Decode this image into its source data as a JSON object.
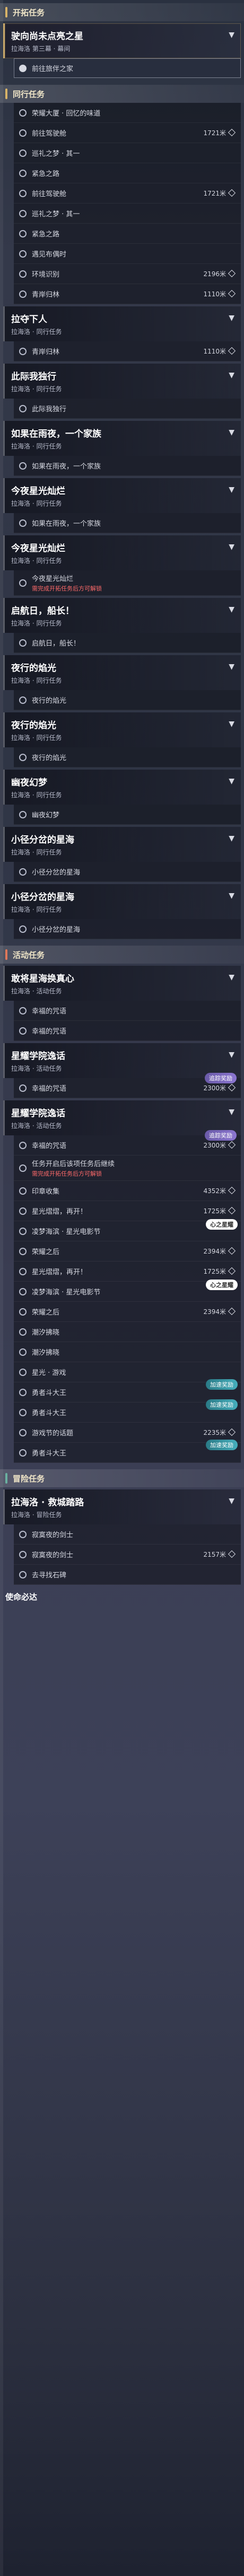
{
  "sections": {
    "trailblaze": {
      "title": "开拓任务"
    },
    "companion": {
      "title": "同行任务"
    },
    "event": {
      "title": "活动任务"
    },
    "adventure": {
      "title": "冒险任务"
    }
  },
  "quests": [
    {
      "title": "驶向尚未点亮之星",
      "sub": "拉海洛 第三幕 · 幕间",
      "steps": [
        {
          "label": "前往旅伴之家",
          "highlight": true
        }
      ]
    },
    {
      "title": "拉夺下人",
      "sub": "拉海洛 · 同行任务"
    },
    {
      "title": "如果在雨夜，一个家族",
      "sub": "拉海洛 · 同行任务"
    },
    {
      "title": "今夜星光灿烂",
      "sub": "拉海洛 · 同行任务"
    },
    {
      "title": "启航日，船长！",
      "sub": "拉海洛 · 同行任务"
    },
    {
      "title": "夜行的焰光",
      "sub": "拉海洛 · 同行任务"
    },
    {
      "title": "幽夜幻梦",
      "sub": "拉海洛 · 同行任务"
    },
    {
      "title": "小径分岔的星海",
      "sub": "拉海洛 · 同行任务"
    },
    {
      "title": "敢将星海换真心",
      "sub": "拉海洛 · 活动任务"
    },
    {
      "title": "星耀学院逸话",
      "sub": "拉海洛 · 活动任务"
    },
    {
      "title": "拉海洛 · 救城踏路",
      "sub": "拉海洛 · 冒险任务"
    },
    {
      "title": "使命必达",
      "sub": ""
    }
  ],
  "steps": {
    "s1": "荣耀大厦 · 回忆的味道",
    "s2": "前往驾驶舱",
    "s3": "巡礼之梦 · 其一",
    "s4": "紧急之路",
    "s5": "前往驾驶舱",
    "s6": "巡礼之梦 · 其一",
    "s7": "紧急之路",
    "s8": "遇见布偶时",
    "s9": "环境识别",
    "s10": "青岸归林",
    "s11": "青岸归林",
    "s12": "此际我独行",
    "s13": "如果在雨夜，一个家族",
    "s14": "如果在雨夜，一个家族",
    "s15": "今夜星光灿烂",
    "s16": "任务开启后该项任务后继续",
    "s17": "启航日，船长！",
    "s18": "夜行的焰光",
    "s19": "夜行的焰光",
    "s20": "幽夜幻梦",
    "s21": "小径分岔的星海",
    "s22": "小径分岔的星海",
    "s23": "幸福的咒语",
    "s24": "幸福的咒语",
    "s25": "幸福的咒语",
    "s26": "星耀学院逸话",
    "s27": "幸福的咒语",
    "s28": "印章收集",
    "s29": "星光熠熠，再开！",
    "s30": "凌梦海滨 · 星光电影节",
    "s31": "荣耀之后",
    "s32": "星光熠熠，再开！",
    "s33": "凌梦海滨 · 星光电影节",
    "s34": "荣耀之后",
    "s35": "潮汐拂晓",
    "s36": "潮汐拂晓",
    "s37": "星光 · 游戏",
    "s38": "勇者斗大王",
    "s39": "勇者斗大王",
    "s40": "游戏节的话题",
    "s41": "勇者斗大王",
    "s42": "寂寞夜的剑士",
    "s43": "寂寞夜的剑士",
    "s44": "去寻找石碑"
  },
  "distances": {
    "d1": "1721米",
    "d2": "1721米",
    "d3": "2196米",
    "d4": "1110米",
    "d5": "1110米",
    "d6": "2300米",
    "d7": "2300米",
    "d8": "4352米",
    "d9": "1725米",
    "d10": "2394米",
    "d11": "1725米",
    "d12": "2394米",
    "d13": "2235米",
    "d14": "2157米"
  },
  "badges": {
    "b1": "追踪奖励",
    "b2": "心之星耀",
    "b3": "加速奖励"
  },
  "warnings": {
    "w1": "需完成开拓任务后方可解锁"
  }
}
